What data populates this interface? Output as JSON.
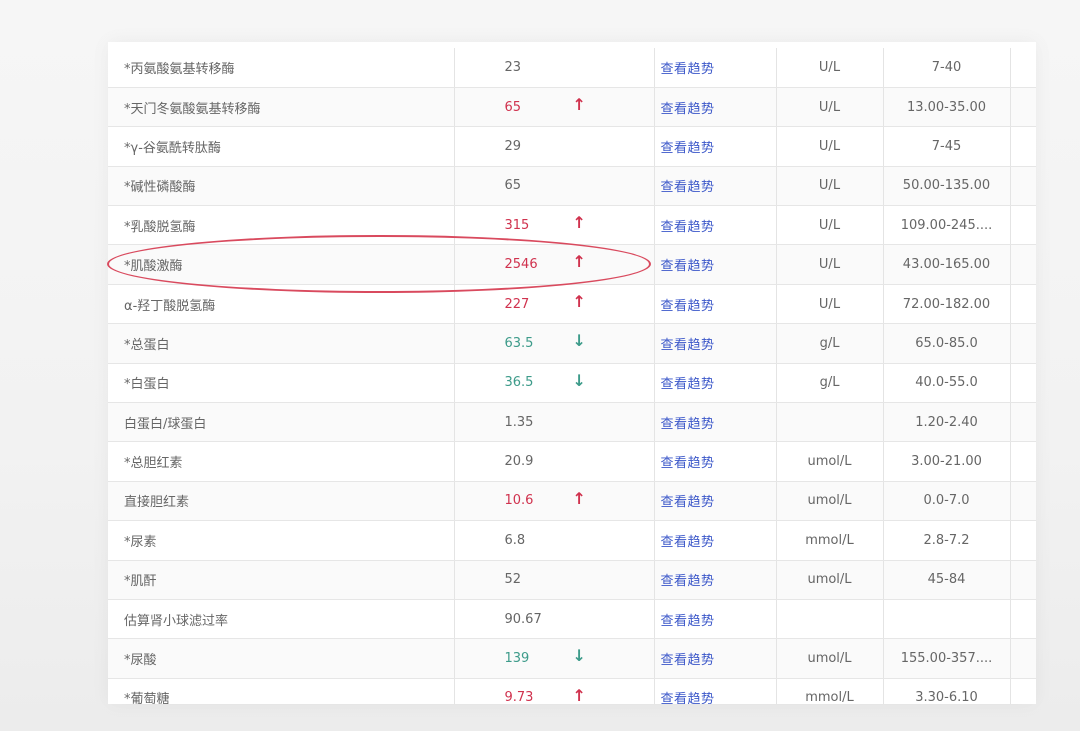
{
  "rows": [
    {
      "name": "*丙氨酸氨基转移酶",
      "value": "23",
      "flag": "normal",
      "trend": "查看趋势",
      "unit": "U/L",
      "ref": "7-40"
    },
    {
      "name": "*天门冬氨酸氨基转移酶",
      "value": "65",
      "flag": "high",
      "trend": "查看趋势",
      "unit": "U/L",
      "ref": "13.00-35.00"
    },
    {
      "name": "*γ-谷氨酰转肽酶",
      "value": "29",
      "flag": "normal",
      "trend": "查看趋势",
      "unit": "U/L",
      "ref": "7-45"
    },
    {
      "name": "*碱性磷酸酶",
      "value": "65",
      "flag": "normal",
      "trend": "查看趋势",
      "unit": "U/L",
      "ref": "50.00-135.00"
    },
    {
      "name": "*乳酸脱氢酶",
      "value": "315",
      "flag": "high",
      "trend": "查看趋势",
      "unit": "U/L",
      "ref": "109.00-245...."
    },
    {
      "name": "*肌酸激酶",
      "value": "2546",
      "flag": "high",
      "trend": "查看趋势",
      "unit": "U/L",
      "ref": "43.00-165.00"
    },
    {
      "name": "α-羟丁酸脱氢酶",
      "value": "227",
      "flag": "high",
      "trend": "查看趋势",
      "unit": "U/L",
      "ref": "72.00-182.00"
    },
    {
      "name": "*总蛋白",
      "value": "63.5",
      "flag": "low",
      "trend": "查看趋势",
      "unit": "g/L",
      "ref": "65.0-85.0"
    },
    {
      "name": "*白蛋白",
      "value": "36.5",
      "flag": "low",
      "trend": "查看趋势",
      "unit": "g/L",
      "ref": "40.0-55.0"
    },
    {
      "name": "白蛋白/球蛋白",
      "value": "1.35",
      "flag": "normal",
      "trend": "查看趋势",
      "unit": "",
      "ref": "1.20-2.40"
    },
    {
      "name": "*总胆红素",
      "value": "20.9",
      "flag": "normal",
      "trend": "查看趋势",
      "unit": "umol/L",
      "ref": "3.00-21.00"
    },
    {
      "name": "直接胆红素",
      "value": "10.6",
      "flag": "high",
      "trend": "查看趋势",
      "unit": "umol/L",
      "ref": "0.0-7.0"
    },
    {
      "name": "*尿素",
      "value": "6.8",
      "flag": "normal",
      "trend": "查看趋势",
      "unit": "mmol/L",
      "ref": "2.8-7.2"
    },
    {
      "name": "*肌酐",
      "value": "52",
      "flag": "normal",
      "trend": "查看趋势",
      "unit": "umol/L",
      "ref": "45-84"
    },
    {
      "name": "估算肾小球滤过率",
      "value": "90.67",
      "flag": "normal",
      "trend": "查看趋势",
      "unit": "",
      "ref": ""
    },
    {
      "name": "*尿酸",
      "value": "139",
      "flag": "low",
      "trend": "查看趋势",
      "unit": "umol/L",
      "ref": "155.00-357...."
    },
    {
      "name": "*葡萄糖",
      "value": "9.73",
      "flag": "high",
      "trend": "查看趋势",
      "unit": "mmol/L",
      "ref": "3.30-6.10"
    }
  ],
  "arrows": {
    "high": "↑",
    "low": "↓"
  },
  "highlighted_row": "*肌酸激酶",
  "colors": {
    "high": "#d0324e",
    "low": "#3d9b8a",
    "link": "#3b57c9",
    "ring": "#d94a5e"
  }
}
